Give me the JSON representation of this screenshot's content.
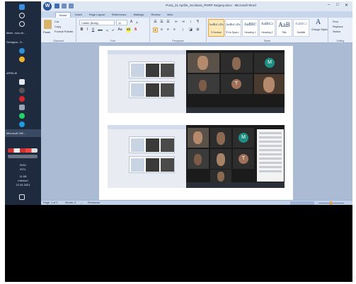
{
  "window": {
    "title": "Poza_21 Aprilie_Scoliosis_PNRP Suigrey.docx - Microsoft Word",
    "minimize": "–",
    "maximize": "□",
    "close": "✕"
  },
  "tabs": [
    "Home",
    "Insert",
    "Page Layout",
    "References",
    "Mailings",
    "Review",
    "View"
  ],
  "ribbon": {
    "clipboard": {
      "label": "Clipboard",
      "paste": "Paste",
      "cut": "Cut",
      "copy": "Copy",
      "format_painter": "Format Painter"
    },
    "font": {
      "label": "Font",
      "name": "Calibri (Body)",
      "size": "11"
    },
    "paragraph": {
      "label": "Paragraph"
    },
    "styles": {
      "label": "Styles",
      "items": [
        {
          "sample": "AaBbCcDc",
          "name": "¶ Normal"
        },
        {
          "sample": "AaBbCcDc",
          "name": "¶ No Spaci..."
        },
        {
          "sample": "AaBbC",
          "name": "Heading 1"
        },
        {
          "sample": "AaBbCc",
          "name": "Heading 2"
        },
        {
          "sample": "AaB",
          "name": "Title"
        },
        {
          "sample": "AaBbCc",
          "name": "Subtitle"
        }
      ],
      "change_styles": "Change Styles"
    },
    "editing": {
      "label": "Editing",
      "find": "Find",
      "replace": "Replace",
      "select": "Select"
    }
  },
  "taskbar": {
    "items": [
      {
        "label": "Meet - kov-ch..."
      },
      {
        "label": "Geolgica - 5..."
      },
      {
        "label": "APRILIE"
      },
      {
        "label": "Microsoft Offi..."
      }
    ],
    "lang": "ROU",
    "layout": "INTL",
    "time": "11:08",
    "day": "miercuri",
    "date": "21.04.2021"
  },
  "document": {
    "avatars": [
      "M",
      "T",
      "M",
      "T"
    ]
  },
  "status": {
    "page": "Page: 1 of 2",
    "words": "Words: 0",
    "language": "Romanian"
  },
  "colors": {
    "accent": "#2b579a",
    "avatar_teal": "#1f8f84",
    "avatar_brown": "#a0705a"
  }
}
